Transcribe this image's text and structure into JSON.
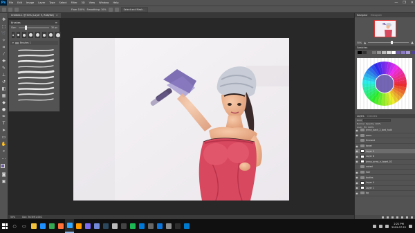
{
  "menubar": {
    "logo": "Ps",
    "items": [
      "File",
      "Edit",
      "Image",
      "Layer",
      "Type",
      "Select",
      "Filter",
      "3D",
      "View",
      "Window",
      "Help"
    ],
    "window_controls": [
      "—",
      "❐",
      "✕"
    ]
  },
  "options": {
    "smoothing": "Smoothing: 10%",
    "flow": "Flow: 100%",
    "select_mask": "Select and Mask..."
  },
  "document": {
    "tab_title": "Untitled-1 @ 50% (Layer 9, RGB/8#)",
    "close": "×"
  },
  "brushes": {
    "title": "Brushes",
    "menu": "≡",
    "size_label": "Size:",
    "size_value": "30 px",
    "group": "Brushes 1",
    "tip_sizes": [
      2,
      3,
      4,
      5,
      5,
      4,
      5,
      6
    ],
    "tip_count": "30"
  },
  "navigator": {
    "tabs": [
      "Navigator",
      "Histogram"
    ],
    "zoom": "50%"
  },
  "swatches": {
    "tabs": [
      "Swatches"
    ],
    "colors": [
      "#000000",
      "#333333",
      "#555555",
      "#777777",
      "#999999",
      "#bbbbbb",
      "#dddddd",
      "#ffffff",
      "#6b5aa6",
      "#8a7ac4",
      "#a99ad8",
      "#4f4090"
    ]
  },
  "layers": {
    "tabs": [
      "Layers",
      "Channels"
    ],
    "kind": "Kind",
    "blend": "Normal",
    "opacity": "Opacity: 100%",
    "lock": "Lock:",
    "fill": "Fill: 100%",
    "rows": [
      {
        "name": "jenny_back_2_bed_hold",
        "type": "folder",
        "visible": true
      },
      {
        "name": "arms",
        "type": "folder",
        "visible": true
      },
      {
        "name": "thrownd",
        "type": "folder",
        "visible": false
      },
      {
        "name": "towel",
        "type": "folder",
        "visible": true
      },
      {
        "name": "Layer 9",
        "type": "layer",
        "visible": true,
        "selected": true
      },
      {
        "name": "Layer 8",
        "type": "layer",
        "visible": true
      },
      {
        "name": "jenny_arms_n_towel_02",
        "type": "layer",
        "visible": true
      },
      {
        "name": "naked",
        "type": "folder",
        "visible": false
      },
      {
        "name": "hair",
        "type": "folder",
        "visible": true
      },
      {
        "name": "bodies",
        "type": "folder",
        "visible": true
      },
      {
        "name": "Layer 4",
        "type": "layer",
        "visible": true
      },
      {
        "name": "Layer 1",
        "type": "layer",
        "visible": true
      },
      {
        "name": "bg",
        "type": "folder",
        "visible": true
      }
    ]
  },
  "status": {
    "zoom": "50%",
    "doc": "Doc: 36.5M/1.04G"
  },
  "taskbar": {
    "time": "2:21 PM",
    "date": "2019-07-22",
    "apps": [
      {
        "name": "file-explorer",
        "color": "#f3c23c"
      },
      {
        "name": "edge",
        "color": "#1e90ff"
      },
      {
        "name": "chrome",
        "color": "#34a853"
      },
      {
        "name": "firefox",
        "color": "#ff7139"
      },
      {
        "name": "photoshop",
        "color": "#31a8ff",
        "active": true
      },
      {
        "name": "illustrator",
        "color": "#ff9a00"
      },
      {
        "name": "media",
        "color": "#7b6cf6"
      },
      {
        "name": "discord",
        "color": "#7289da"
      },
      {
        "name": "steam",
        "color": "#2a475e"
      },
      {
        "name": "notepad",
        "color": "#bbbbbb"
      },
      {
        "name": "obs",
        "color": "#444444"
      },
      {
        "name": "spotify",
        "color": "#1db954"
      },
      {
        "name": "mail",
        "color": "#0078d7"
      },
      {
        "name": "calc",
        "color": "#666666"
      },
      {
        "name": "store",
        "color": "#0a74da"
      },
      {
        "name": "settings",
        "color": "#8e8e8e"
      },
      {
        "name": "terminal",
        "color": "#2d2d2d"
      },
      {
        "name": "vscode",
        "color": "#007acc"
      }
    ]
  }
}
